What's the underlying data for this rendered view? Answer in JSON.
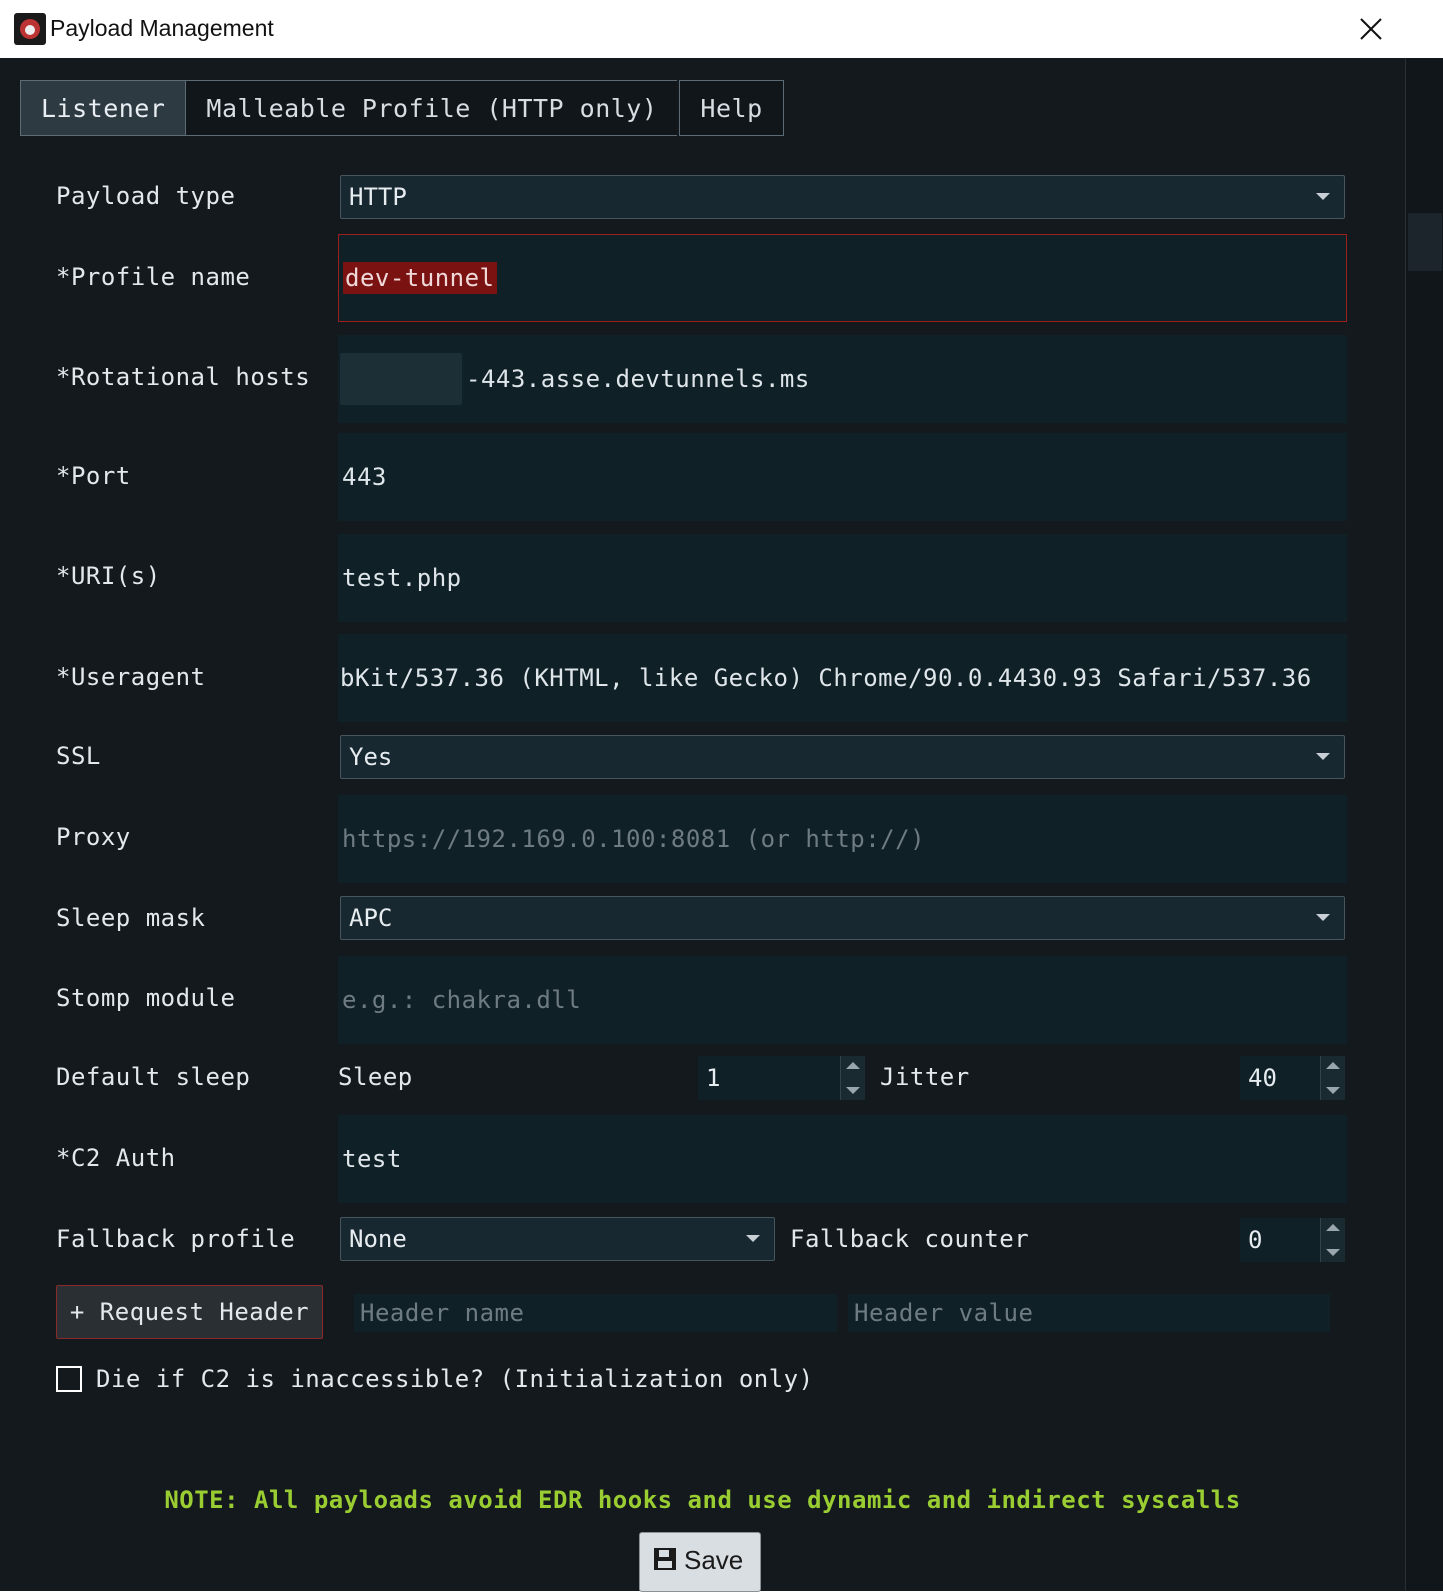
{
  "window": {
    "title": "Payload Management"
  },
  "tabs": [
    {
      "label": "Listener",
      "active": true
    },
    {
      "label": "Malleable Profile (HTTP only)",
      "active": false
    },
    {
      "label": "Help",
      "active": false
    }
  ],
  "form": {
    "payload_type": {
      "label": "Payload type",
      "value": "HTTP"
    },
    "profile_name": {
      "label": "*Profile name",
      "value": "dev-tunnel"
    },
    "rotational_hosts": {
      "label": "*Rotational hosts",
      "value": "-443.asse.devtunnels.ms"
    },
    "port": {
      "label": "*Port",
      "value": "443"
    },
    "uris": {
      "label": "*URI(s)",
      "value": "test.php"
    },
    "useragent": {
      "label": "*Useragent",
      "value": "bKit/537.36 (KHTML, like Gecko) Chrome/90.0.4430.93 Safari/537.36"
    },
    "ssl": {
      "label": "SSL",
      "value": "Yes"
    },
    "proxy": {
      "label": "Proxy",
      "placeholder": "https://192.169.0.100:8081 (or http://)"
    },
    "sleep_mask": {
      "label": "Sleep mask",
      "value": "APC"
    },
    "stomp_module": {
      "label": "Stomp module",
      "placeholder": "e.g.: chakra.dll"
    },
    "default_sleep": {
      "label": "Default sleep",
      "sleep_label": "Sleep",
      "sleep_value": "1",
      "jitter_label": "Jitter",
      "jitter_value": "40"
    },
    "c2_auth": {
      "label": "*C2 Auth",
      "value": "test"
    },
    "fallback": {
      "label": "Fallback profile",
      "value": "None",
      "counter_label": "Fallback counter",
      "counter_value": "0"
    },
    "request_header": {
      "button_label": "+ Request Header",
      "name_placeholder": "Header name",
      "value_placeholder": "Header value"
    },
    "die_if_inaccessible": {
      "label": "Die if C2 is inaccessible? (Initialization only)",
      "checked": false
    }
  },
  "note": "NOTE: All payloads avoid EDR hooks and use dynamic and indirect syscalls",
  "save_label": "Save"
}
